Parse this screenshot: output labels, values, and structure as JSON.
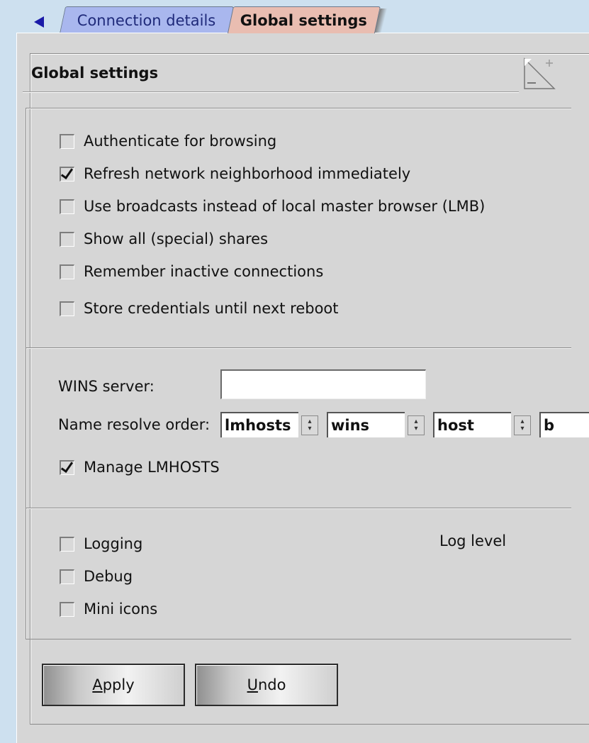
{
  "tabs": {
    "items": [
      {
        "label": "Connection details"
      },
      {
        "label": "Global settings"
      }
    ]
  },
  "panel": {
    "title": "Global settings"
  },
  "browsing": {
    "checkboxes": [
      {
        "label": "Authenticate for browsing",
        "checked": false
      },
      {
        "label": "Refresh network neighborhood immediately",
        "checked": true
      },
      {
        "label": "Use broadcasts instead of local master browser (LMB)",
        "checked": false
      },
      {
        "label": "Show all (special) shares",
        "checked": false
      },
      {
        "label": "Remember inactive connections",
        "checked": false
      },
      {
        "label": "Store credentials until next reboot",
        "checked": false
      }
    ]
  },
  "name_resolution": {
    "wins_label": "WINS server:",
    "wins_value": "",
    "resolve_label": "Name resolve order:",
    "resolve_order": [
      "lmhosts",
      "wins",
      "host",
      "b"
    ],
    "manage_lmhosts": {
      "label": "Manage LMHOSTS",
      "checked": true
    }
  },
  "misc": {
    "checkboxes": [
      {
        "label": "Logging",
        "checked": false
      },
      {
        "label": "Debug",
        "checked": false
      },
      {
        "label": "Mini icons",
        "checked": false
      }
    ],
    "log_level_label": "Log level"
  },
  "buttons": {
    "apply": {
      "mnemonic": "A",
      "rest": "pply"
    },
    "undo": {
      "mnemonic": "U",
      "rest": "ndo"
    }
  }
}
